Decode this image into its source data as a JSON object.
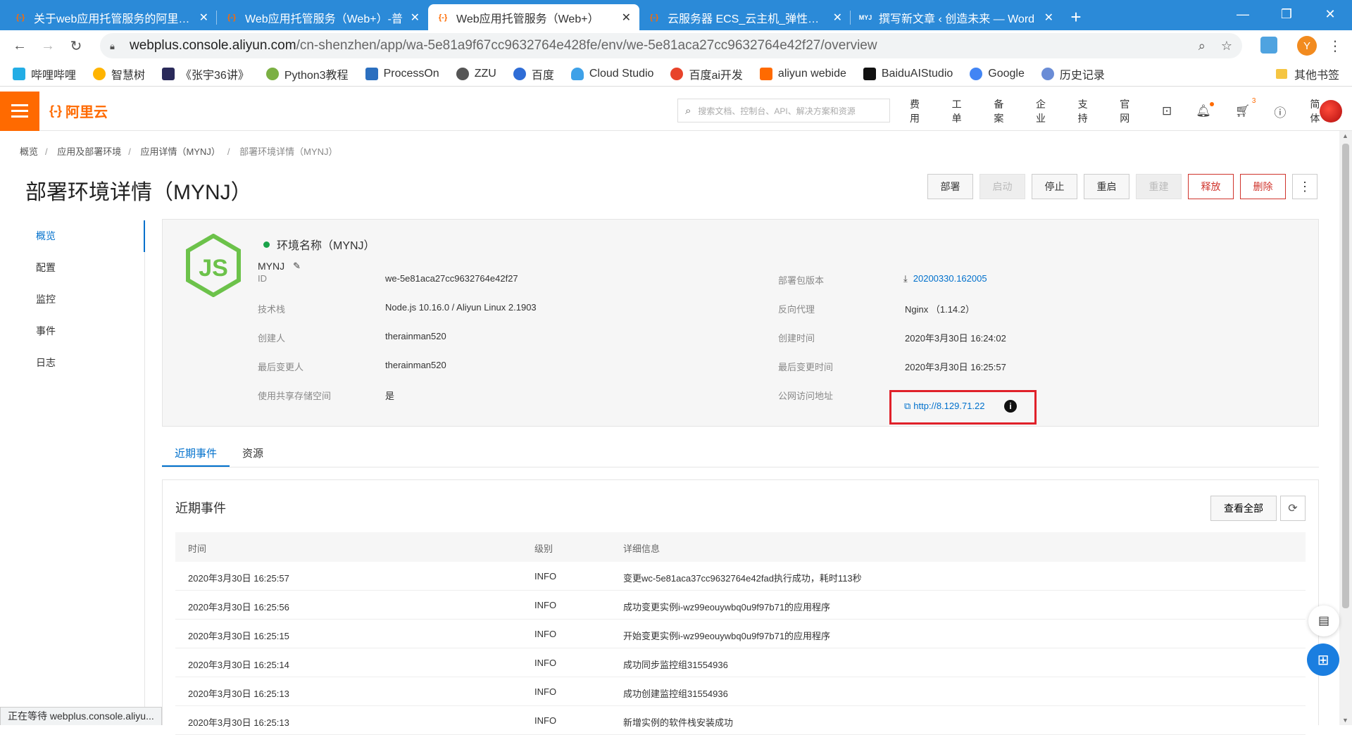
{
  "browser": {
    "tabs": [
      {
        "title": "关于web应用托管服务的阿里云F",
        "active": false
      },
      {
        "title": "Web应用托管服务（Web+）-普",
        "active": false
      },
      {
        "title": "Web应用托管服务（Web+）",
        "active": true
      },
      {
        "title": "云服务器 ECS_云主机_弹性计算",
        "active": false
      },
      {
        "title": "撰写新文章 ‹ 创造未来 — Word",
        "active": false
      }
    ],
    "tab_badge_last": "MYJ",
    "url_host": "webplus.console.aliyun.com",
    "url_path": "/cn-shenzhen/app/wa-5e81a9f67cc9632764e428fe/env/we-5e81aca27cc9632764e42f27/overview",
    "profile_initial": "Y",
    "status_text": "正在等待 webplus.console.aliyu..."
  },
  "bookmarks": [
    "哔哩哔哩",
    "智慧树",
    "《张宇36讲》",
    "Python3教程",
    "ProcessOn",
    "ZZU",
    "百度",
    "Cloud Studio",
    "百度ai开发",
    "aliyun webide",
    "BaiduAIStudio",
    "Google",
    "历史记录"
  ],
  "bookmarks_other": "其他书签",
  "topnav": {
    "logo_text": "阿里云",
    "search_placeholder": "搜索文档、控制台、API、解决方案和资源",
    "links": [
      "费用",
      "工单",
      "备案",
      "企业",
      "支持",
      "官网"
    ],
    "cart_count": "3",
    "lang": "简体"
  },
  "breadcrumb": [
    "概览",
    "应用及部署环境",
    "应用详情（MYNJ）",
    "部署环境详情（MYNJ）"
  ],
  "page_title": "部署环境详情（MYNJ）",
  "actions": [
    {
      "label": "部署",
      "state": "normal"
    },
    {
      "label": "启动",
      "state": "disabled"
    },
    {
      "label": "停止",
      "state": "normal"
    },
    {
      "label": "重启",
      "state": "normal"
    },
    {
      "label": "重建",
      "state": "disabled"
    },
    {
      "label": "释放",
      "state": "danger"
    },
    {
      "label": "删除",
      "state": "danger"
    }
  ],
  "sidenav": [
    "概览",
    "配置",
    "监控",
    "事件",
    "日志"
  ],
  "env": {
    "name_label": "环境名称（MYNJ）",
    "name": "MYNJ",
    "left": [
      {
        "label": "ID",
        "value": "we-5e81aca27cc9632764e42f27"
      },
      {
        "label": "技术栈",
        "value": "Node.js 10.16.0 / Aliyun Linux 2.1903"
      },
      {
        "label": "创建人",
        "value": "therainman520"
      },
      {
        "label": "最后变更人",
        "value": "therainman520"
      },
      {
        "label": "使用共享存储空间",
        "value": "是"
      }
    ],
    "right": [
      {
        "label": "部署包版本",
        "value": "20200330.162005"
      },
      {
        "label": "反向代理",
        "value": "Nginx （1.14.2）"
      },
      {
        "label": "创建时间",
        "value": "2020年3月30日 16:24:02"
      },
      {
        "label": "最后变更时间",
        "value": "2020年3月30日 16:25:57"
      },
      {
        "label": "公网访问地址",
        "value": "http://8.129.71.22"
      }
    ]
  },
  "tabs2": [
    "近期事件",
    "资源"
  ],
  "events": {
    "title": "近期事件",
    "view_all": "查看全部",
    "headers": [
      "时间",
      "级别",
      "详细信息"
    ],
    "rows": [
      [
        "2020年3月30日 16:25:57",
        "INFO",
        "变更wc-5e81aca37cc9632764e42fad执行成功，耗时113秒"
      ],
      [
        "2020年3月30日 16:25:56",
        "INFO",
        "成功变更实例i-wz99eouywbq0u9f97b71的应用程序"
      ],
      [
        "2020年3月30日 16:25:15",
        "INFO",
        "开始变更实例i-wz99eouywbq0u9f97b71的应用程序"
      ],
      [
        "2020年3月30日 16:25:14",
        "INFO",
        "成功同步监控组31554936"
      ],
      [
        "2020年3月30日 16:25:13",
        "INFO",
        "成功创建监控组31554936"
      ],
      [
        "2020年3月30日 16:25:13",
        "INFO",
        "新增实例的软件栈安装成功"
      ]
    ]
  }
}
